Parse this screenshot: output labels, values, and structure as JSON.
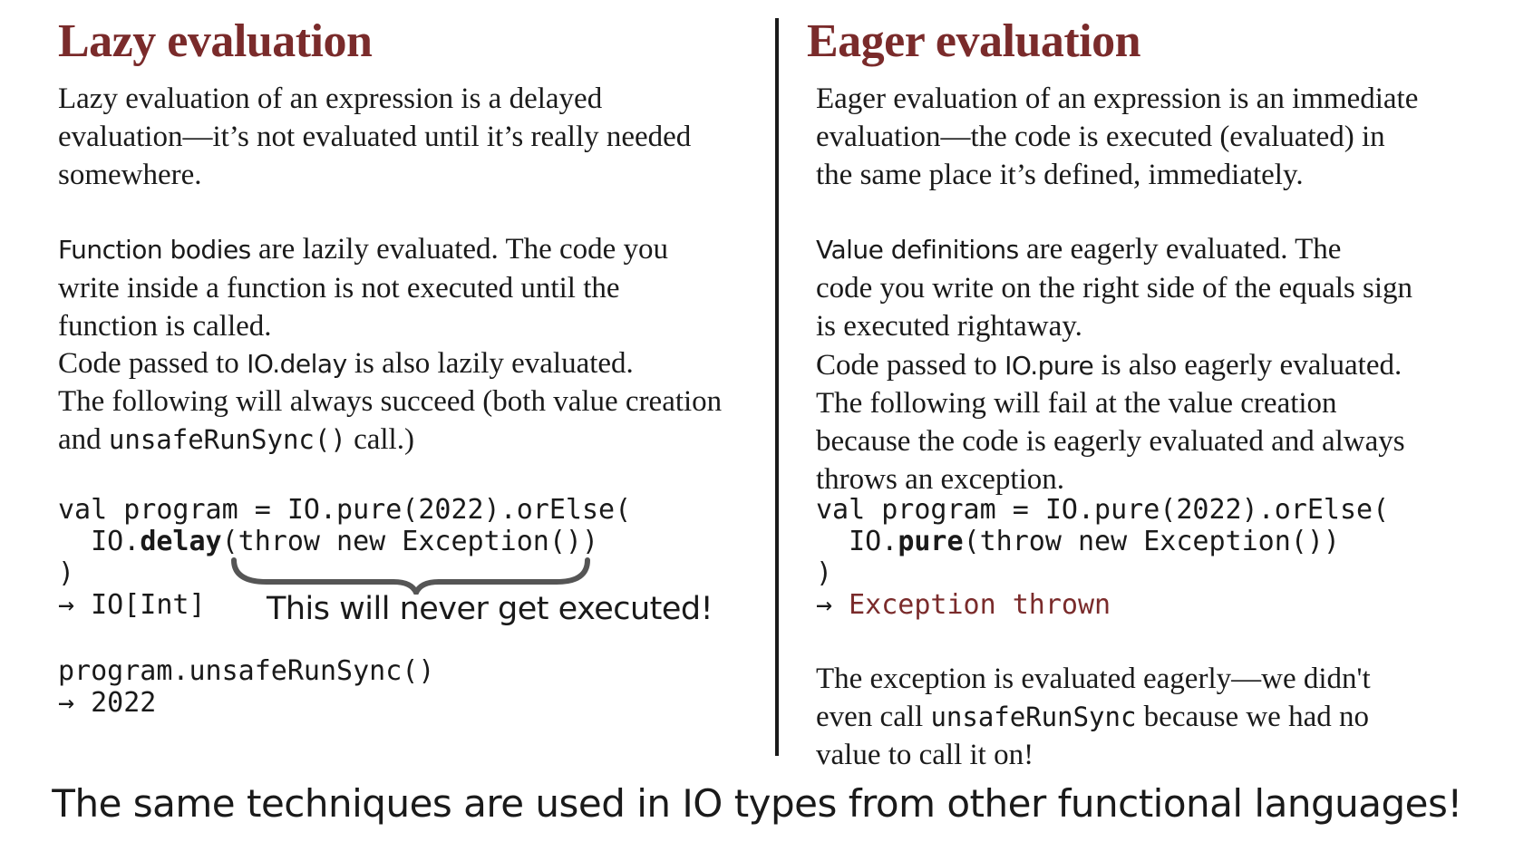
{
  "lazy": {
    "title": "Lazy evaluation",
    "intro_lines": [
      "Lazy evaluation of an expression is a delayed",
      "evaluation—it’s not evaluated until it’s  really needed",
      "somewhere."
    ],
    "p2_term": "Function bodies",
    "p2_line1_rest": " are lazily evaluated. The code you",
    "p2_line2": "write inside a function is not executed until the",
    "p2_line3": "function is called.",
    "p3_prefix": "Code passed to ",
    "p3_term": "IO.delay",
    "p3_suffix": " is also lazily evaluated.",
    "p4_line1": "The following will always succeed (both value creation",
    "p4_prefix": "and ",
    "p4_code": "unsafeRunSync()",
    "p4_suffix": " call.)",
    "code_line1": "val program = IO.pure(2022).orElse(",
    "code_line2_pre": "  IO.",
    "code_line2_bold": "delay",
    "code_line2_post": "(throw new Exception())",
    "code_line3": ")",
    "code_line4": "→ IO[Int]",
    "annotation": "This will never get executed!",
    "run_line1": "program.unsafeRunSync()",
    "run_line2": "→ 2022"
  },
  "eager": {
    "title": "Eager evaluation",
    "intro_lines": [
      "Eager evaluation of an expression is an immediate",
      "evaluation—the code is executed (evaluated) in",
      "the same place it’s defined, immediately."
    ],
    "p2_term": "Value definitions",
    "p2_line1_rest": " are eagerly evaluated. The",
    "p2_line2": "code you write on the right side of the equals sign",
    "p2_line3": "is executed rightaway.",
    "p3_prefix": "Code passed to ",
    "p3_term": "IO.pure",
    "p3_suffix": " is also eagerly evaluated.",
    "p4_lines": [
      "The following will fail at the value creation",
      "because the code is eagerly evaluated and always",
      "throws an exception."
    ],
    "code_line1": "val program = IO.pure(2022).orElse(",
    "code_line2_pre": "  IO.",
    "code_line2_bold": "pure",
    "code_line2_post": "(throw new Exception())",
    "code_line3": ")",
    "code_arrow": "→ ",
    "code_result": "Exception thrown",
    "p5_line1": "The exception is evaluated eagerly—we didn't",
    "p5_prefix": "even call ",
    "p5_code": "unsafeRunSync",
    "p5_suffix": " because we had no",
    "p5_line3": "value to call it on!"
  },
  "footer": "The same techniques are used in IO types from other functional languages!",
  "colors": {
    "title": "#7a2b2b",
    "text": "#1a1a1a",
    "result": "#7a2b2b"
  }
}
